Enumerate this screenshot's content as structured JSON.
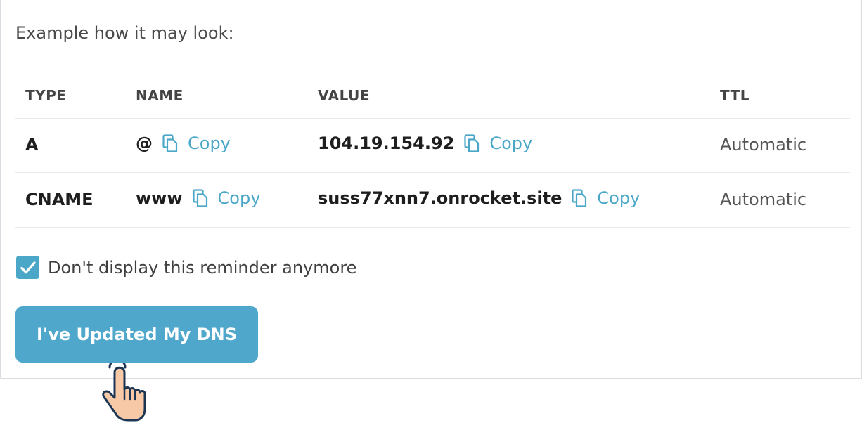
{
  "intro": "Example how it may look:",
  "table": {
    "headers": [
      "TYPE",
      "NAME",
      "VALUE",
      "TTL"
    ],
    "rows": [
      {
        "type": "A",
        "name": "@",
        "value": "104.19.154.92",
        "ttl": "Automatic"
      },
      {
        "type": "CNAME",
        "name": "www",
        "value": "suss77xnn7.onrocket.site",
        "ttl": "Automatic"
      }
    ],
    "copy_label": "Copy"
  },
  "reminder": {
    "label": "Don't display this reminder anymore",
    "checked": true
  },
  "primary_button": "I've Updated My DNS",
  "colors": {
    "accent": "#4aa7c8",
    "button": "#4fa8cb",
    "hand_fill": "#f7c9a6",
    "hand_stroke": "#1c3553"
  },
  "icons": [
    "copy-icon",
    "checkmark-icon",
    "pointer-hand-icon"
  ]
}
